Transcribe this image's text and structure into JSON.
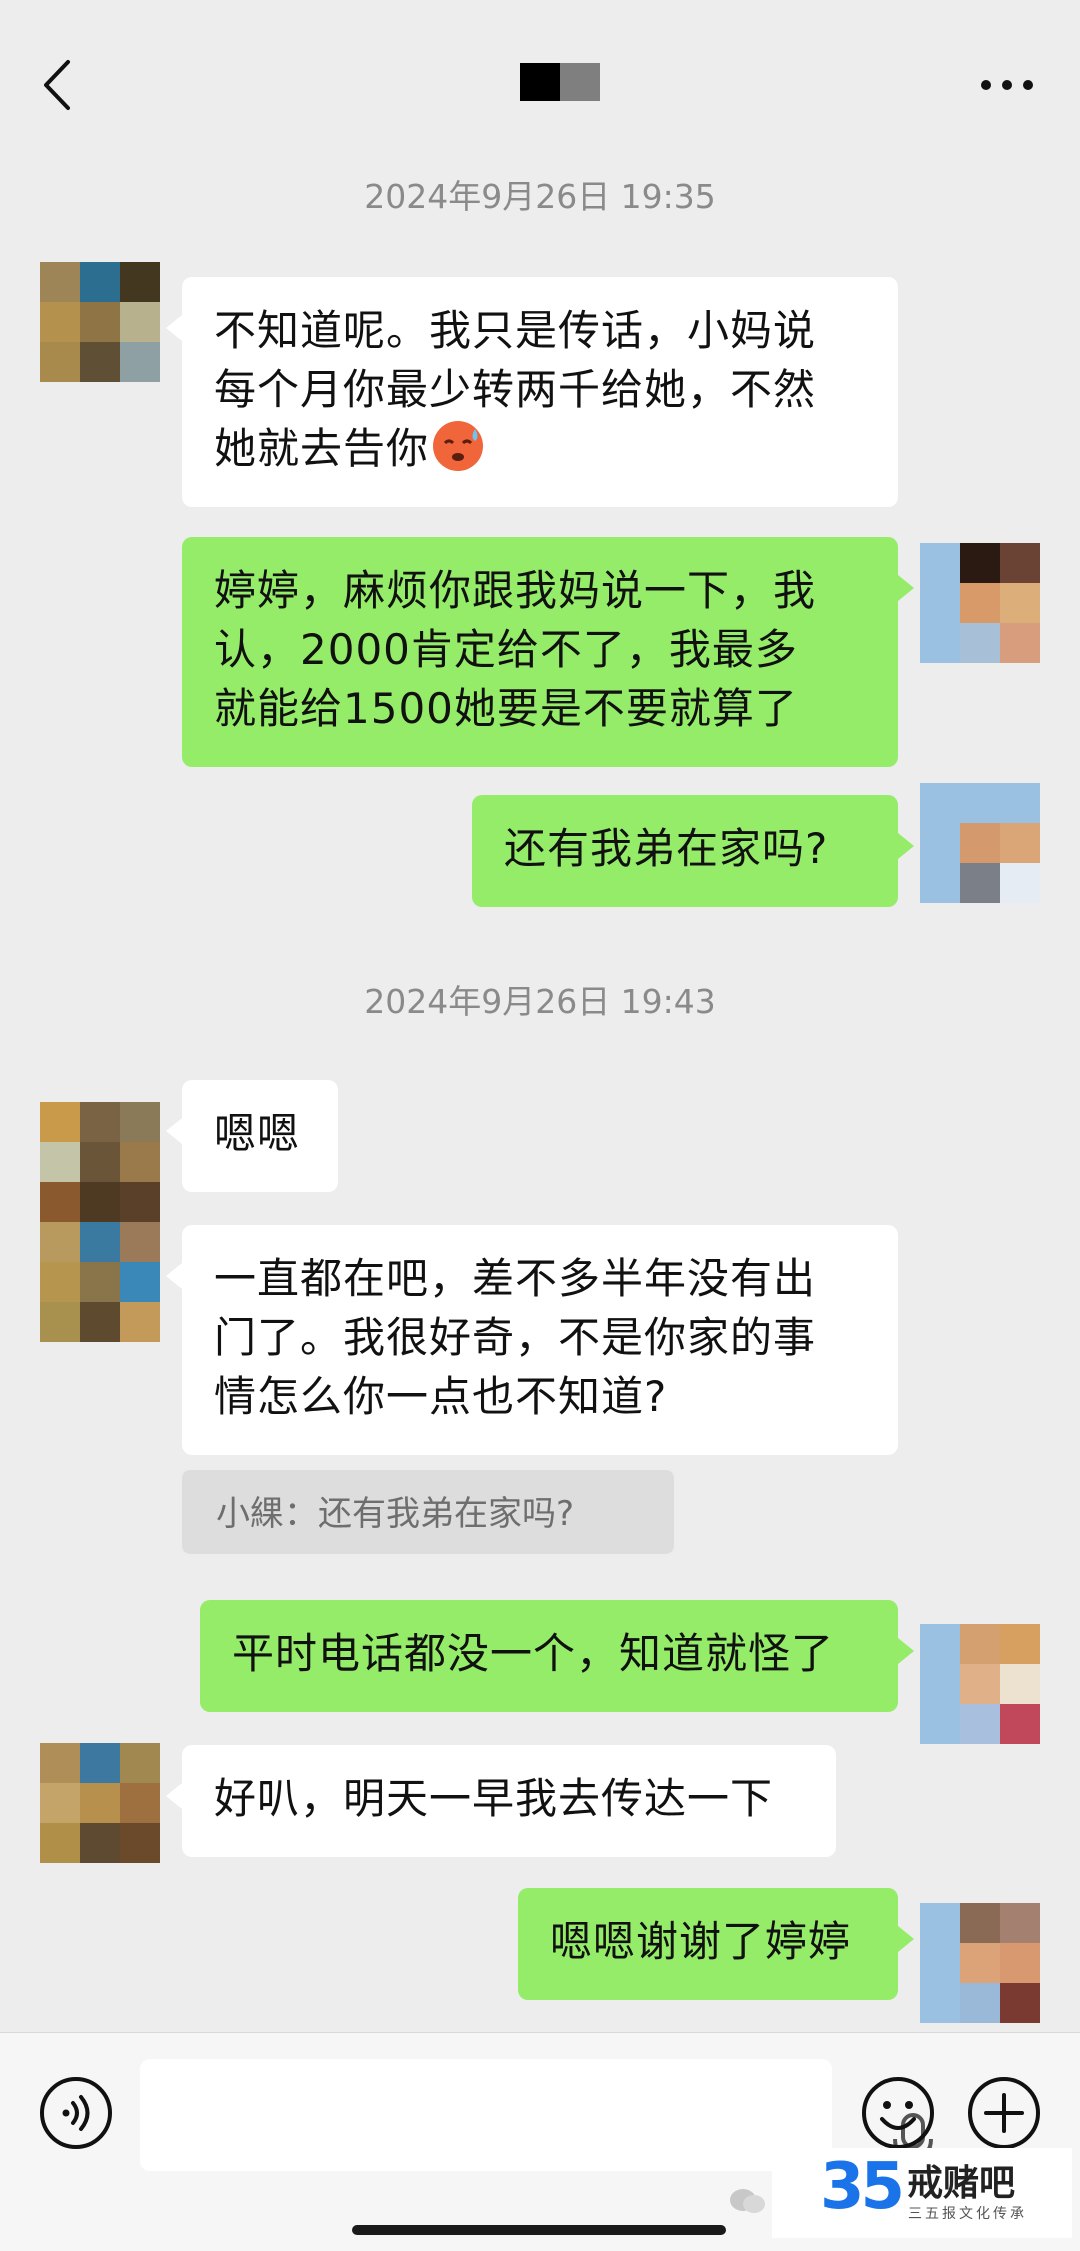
{
  "header": {
    "back_icon": "chevron-left-icon",
    "more_icon": "more-dots-icon"
  },
  "timestamps": [
    "2024年9月26日 19:35",
    "2024年9月26日 19:43"
  ],
  "messages": [
    {
      "side": "in",
      "lines": [
        "不知道呢。我只是传话，小妈说",
        "每个月你最少转两千给她，不然",
        "她就去告你"
      ],
      "emoji": "cold-sweat-face-emoji"
    },
    {
      "side": "out",
      "lines": [
        "婷婷，麻烦你跟我妈说一下，我",
        "认，2000肯定给不了，我最多",
        "就能给1500她要是不要就算了"
      ]
    },
    {
      "side": "out",
      "lines": [
        "还有我弟在家吗?"
      ]
    },
    {
      "side": "in",
      "lines": [
        "嗯嗯"
      ]
    },
    {
      "side": "in",
      "lines": [
        "一直都在吧，差不多半年没有出",
        "门了。我很好奇，不是你家的事",
        "情怎么你一点也不知道?"
      ]
    },
    {
      "side": "out",
      "lines": [
        "平时电话都没一个，知道就怪了"
      ]
    },
    {
      "side": "in",
      "lines": [
        "好叭，明天一早我去传达一下"
      ]
    },
    {
      "side": "out",
      "lines": [
        "嗯嗯谢谢了婷婷"
      ]
    }
  ],
  "quote": {
    "text": "小綶：还有我弟在家吗?"
  },
  "input_bar": {
    "voice_icon": "voice-icon",
    "mic_icon": "microphone-icon",
    "emoji_icon": "smiley-icon",
    "plus_icon": "plus-icon"
  },
  "watermark": {
    "number": "35",
    "name": "戒赌吧",
    "subtitle": "三五报文化传承"
  },
  "colors": {
    "background": "#ededed",
    "incoming_bubble": "#ffffff",
    "outgoing_bubble": "#95ec69",
    "timestamp": "#8a8a8a"
  }
}
